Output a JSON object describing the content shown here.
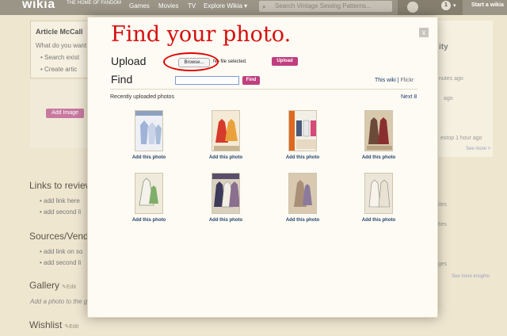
{
  "topnav": {
    "brand": "wikia",
    "tagline": "THE HOME OF FANDOM",
    "items": [
      "Games",
      "Movies",
      "TV",
      "Explore Wikia"
    ],
    "search_placeholder": "Search Vintage Sewing Patterns...",
    "notification_count": "1",
    "start_wiki": "Start a wikia"
  },
  "background_page": {
    "article_title": "Article McCall",
    "article_prompt": "What do you want",
    "article_bullets": [
      "Search exist",
      "Create artic"
    ],
    "add_image_label": "Add Image",
    "sections": [
      {
        "heading": "Links to review",
        "items": [
          "add link here",
          "add second li"
        ]
      },
      {
        "heading": "Sources/Vendo",
        "items": [
          "add link on so",
          "add second li"
        ]
      },
      {
        "heading": "Gallery",
        "edit": "Edit",
        "note": "Add a photo to the g"
      },
      {
        "heading": "Wishlist",
        "edit": "Edit"
      }
    ],
    "side_panel": {
      "fragments": [
        "ity",
        "nutes ago",
        "ago",
        "estop 1 hour ago",
        "ites",
        "ties",
        "ges"
      ],
      "links": [
        "See more >",
        "See more insights"
      ]
    }
  },
  "modal": {
    "title": "Find your photo.",
    "close": "x",
    "upload": {
      "label": "Upload",
      "browse": "Browse...",
      "no_file": "No file selected.",
      "button": "Upload"
    },
    "find": {
      "label": "Find",
      "button": "Find",
      "source_this_wiki": "This wiki",
      "source_separator": "|",
      "source_flickr": "Flickr"
    },
    "recent_label": "Recently uploaded photos",
    "next_label": "Next 8",
    "photos": [
      {
        "caption": "Add this photo"
      },
      {
        "caption": "Add this photo"
      },
      {
        "caption": "Add this photo"
      },
      {
        "caption": "Add this photo"
      },
      {
        "caption": "Add this photo"
      },
      {
        "caption": "Add this photo"
      },
      {
        "caption": "Add this photo"
      },
      {
        "caption": "Add this photo"
      }
    ]
  },
  "colors": {
    "title_red": "#d60f0f",
    "button_pink": "#bf3f7f",
    "link_blue": "#26446f"
  }
}
